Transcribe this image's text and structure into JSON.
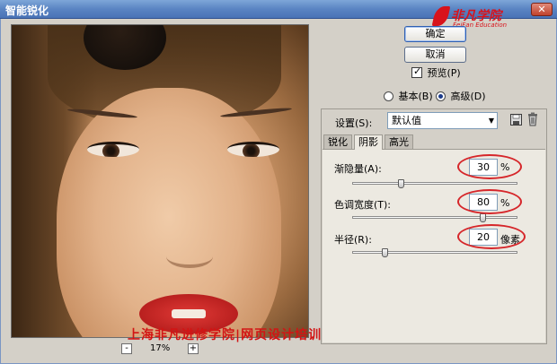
{
  "window": {
    "title": "智能锐化",
    "close_glyph": "✕"
  },
  "logo": {
    "name": "非凡学院",
    "tagline": "FeiFan Education"
  },
  "buttons": {
    "ok": "确定",
    "cancel": "取消"
  },
  "preview_checkbox": {
    "label": "预览(P)",
    "checked": true
  },
  "mode": {
    "basic": "基本(B)",
    "advanced": "高级(D)",
    "selected": "advanced"
  },
  "settings": {
    "label": "设置(S):",
    "value": "默认值"
  },
  "tabs": [
    "锐化",
    "阴影",
    "高光"
  ],
  "active_tab": "阴影",
  "params": [
    {
      "label": "渐隐量(A):",
      "value": "30",
      "unit": "%",
      "slider_fraction": 0.29
    },
    {
      "label": "色调宽度(T):",
      "value": "80",
      "unit": "%",
      "slider_fraction": 0.79
    },
    {
      "label": "半径(R):",
      "value": "20",
      "unit": "像素",
      "slider_fraction": 0.19
    }
  ],
  "zoom": {
    "minus": "-",
    "plus": "+",
    "level": "17%"
  },
  "watermark": "上海非凡进修学院|网页设计培训",
  "colors": {
    "annotation_red": "#d6262a",
    "titlebar_blue": "#5a84c3",
    "logo_red": "#d8131b"
  }
}
